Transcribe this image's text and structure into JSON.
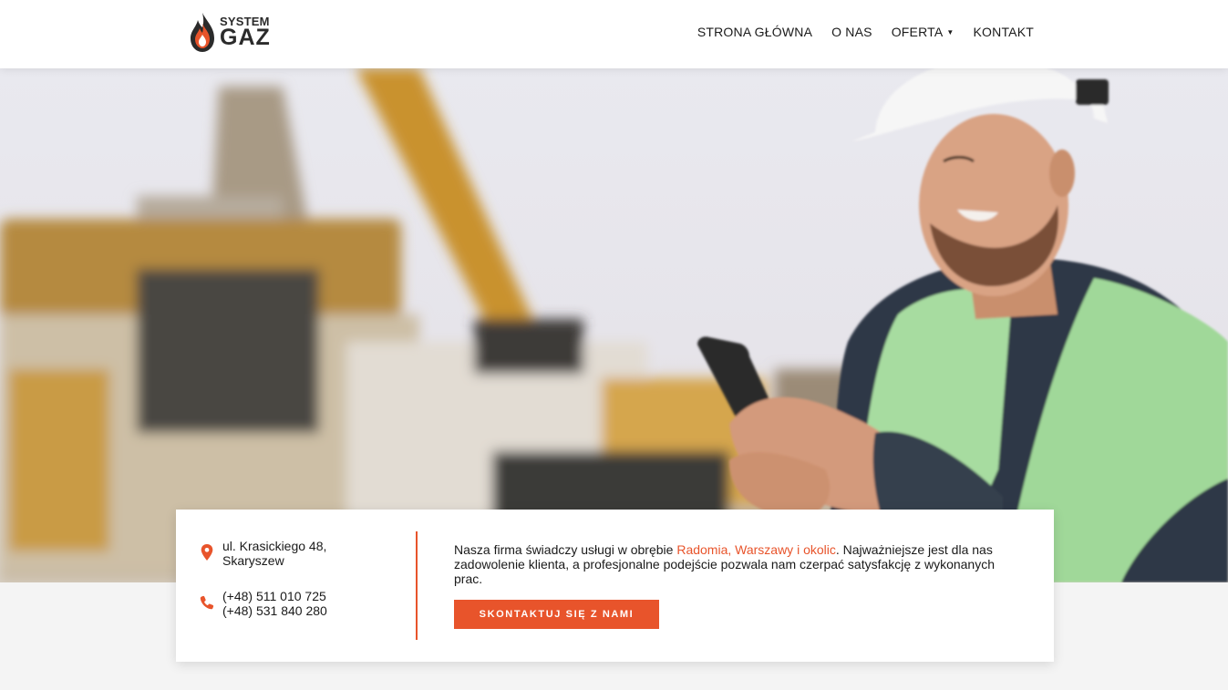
{
  "brand": {
    "line1": "SYSTEM",
    "line2": "GAZ",
    "accent_color": "#e8542b"
  },
  "nav": {
    "items": [
      {
        "label": "STRONA GŁÓWNA"
      },
      {
        "label": "O NAS"
      },
      {
        "label": "OFERTA",
        "has_dropdown": true
      },
      {
        "label": "KONTAKT"
      }
    ]
  },
  "hero": {
    "image_description_icon": "construction-worker-photo"
  },
  "contact": {
    "address_line1": "ul. Krasickiego 48,",
    "address_line2": "Skaryszew",
    "phone1": "(+48) 511 010 725",
    "phone2": "(+48) 531 840 280",
    "address_icon": "map-pin-icon",
    "phone_icon": "phone-icon"
  },
  "info": {
    "text_before": "Nasza firma świadczy usługi w obrębie ",
    "text_highlight": "Radomia, Warszawy i okolic",
    "text_after": ". Najważniejsze jest dla nas zadowolenie klienta, a profesjonalne podejście pozwala nam czerpać satysfakcję z wykonanych prac.",
    "cta_label": "SKONTAKTUJ SIĘ Z NAMI"
  }
}
